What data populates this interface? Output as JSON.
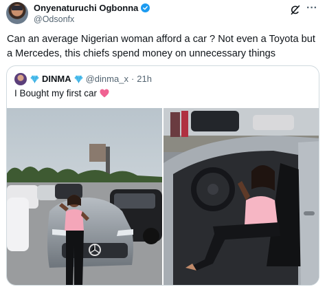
{
  "tweet": {
    "author_name": "Onyenaturuchi Ogbonna",
    "author_handle": "@Odsonfx",
    "text": "Can an average Nigerian woman afford a car ? Not even a Toyota but a Mercedes, this chiefs spend money on unnecessary things"
  },
  "quote": {
    "author_name": "DINMA",
    "author_handle": "@dinma_x",
    "separator": "·",
    "time": "21h",
    "text": "I Bought my first car"
  },
  "icons": {
    "verified": "verified-badge-icon",
    "grok": "grok-icon",
    "more": "more-icon",
    "gem": "gem-icon",
    "heart": "heart-icon"
  },
  "colors": {
    "accent": "#1d9bf0",
    "secondary_text": "#536471",
    "heart": "#f06292",
    "border": "#cfd9de"
  }
}
